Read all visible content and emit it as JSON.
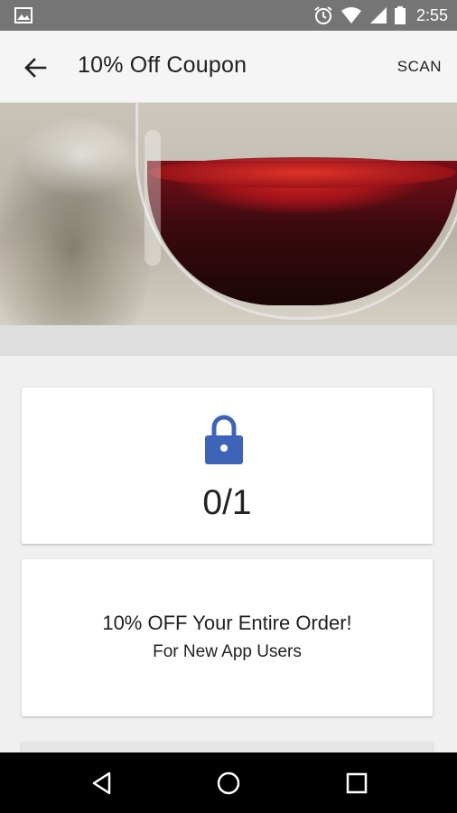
{
  "status_bar": {
    "time": "2:55",
    "icons": [
      "gallery-icon",
      "alarm-icon",
      "wifi-icon",
      "signal-icon",
      "battery-icon"
    ]
  },
  "app_bar": {
    "title": "10% Off Coupon",
    "scan_label": "SCAN",
    "back_icon": "arrow-back-icon"
  },
  "hero": {
    "image_subject": "glass of red wine"
  },
  "redemption": {
    "count": "0/1",
    "icon": "lock-icon"
  },
  "offer": {
    "title": "10% OFF Your Entire Order!",
    "subtitle": "For New App Users"
  },
  "colors": {
    "status_bar": "#757575",
    "app_bar": "#f5f5f5",
    "accent": "#3d64b8",
    "background": "#f0f0f0",
    "nav_bar": "#000000"
  }
}
